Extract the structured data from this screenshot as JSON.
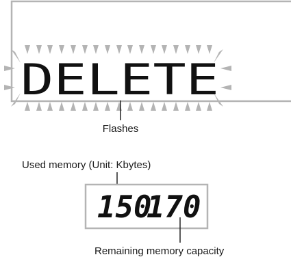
{
  "display_message": "DELETE",
  "flash_callout": "Flashes",
  "memory_display": {
    "used_value": "150",
    "remaining_value": "170",
    "used_label": "Used memory (Unit: Kbytes)",
    "remaining_label": "Remaining memory capacity"
  },
  "colors": {
    "frame": "#b4b4b4",
    "indicator": "#b4b4b4",
    "text": "#111111",
    "callout_line": "#222222"
  }
}
